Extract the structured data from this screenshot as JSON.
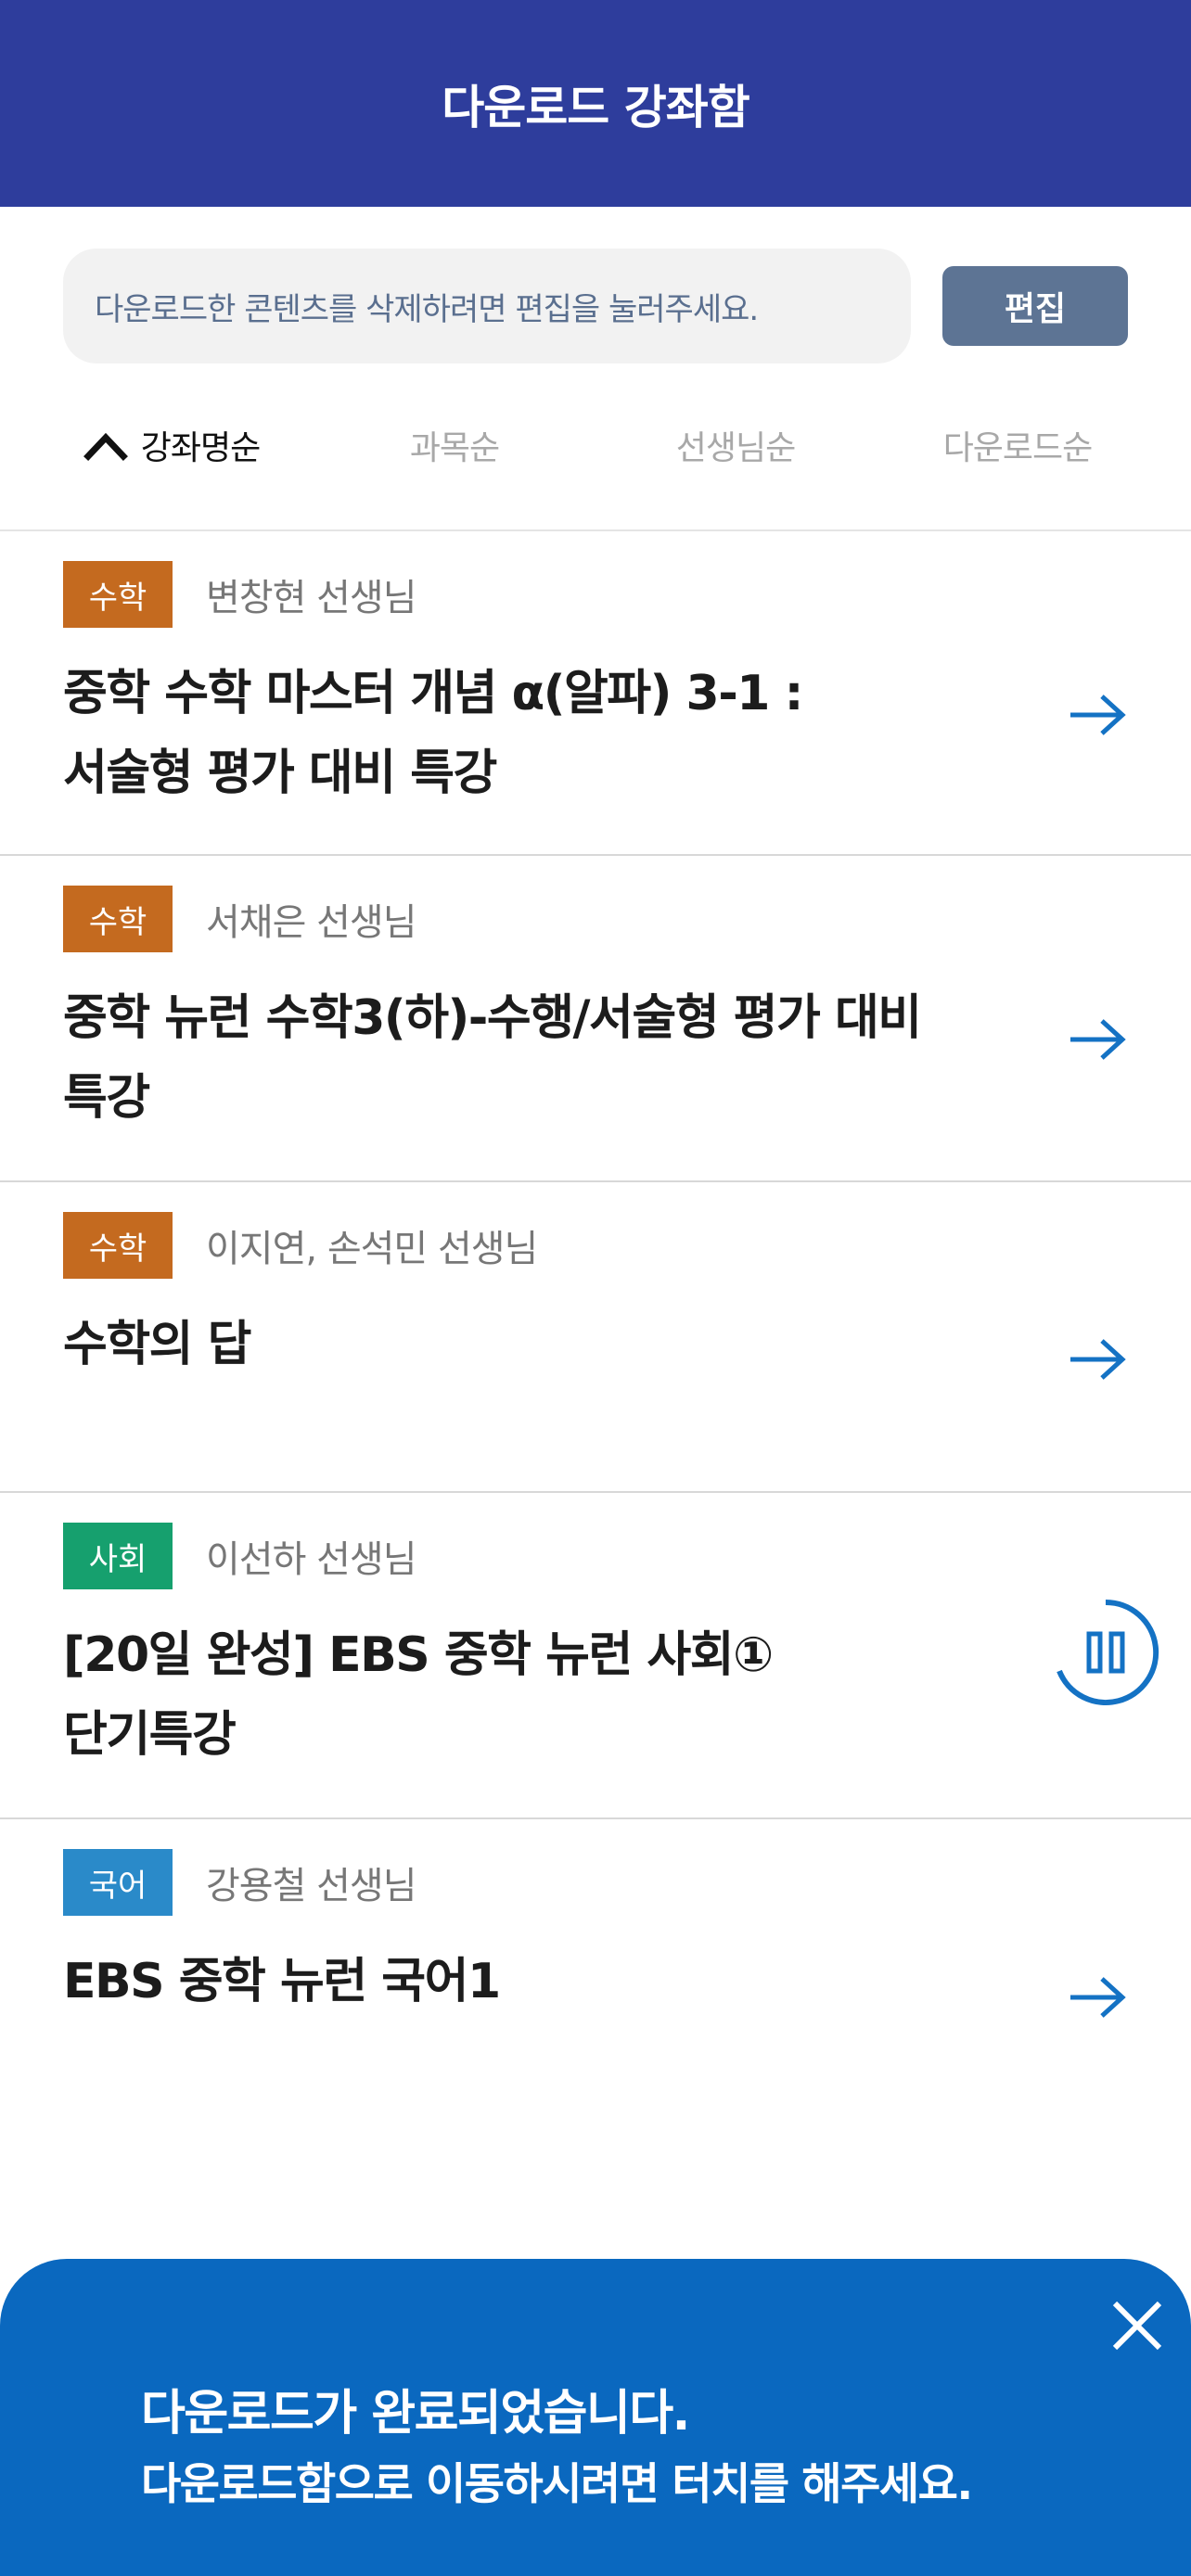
{
  "header": {
    "title": "다운로드 강좌함"
  },
  "info": {
    "message": "다운로드한 콘텐츠를 삭제하려면 편집을 눌러주세요.",
    "edit_label": "편집"
  },
  "sort": {
    "tabs": [
      {
        "label": "강좌명순",
        "active": true,
        "icon": "chevron-up-icon"
      },
      {
        "label": "과목순",
        "active": false
      },
      {
        "label": "선생님순",
        "active": false
      },
      {
        "label": "다운로드순",
        "active": false
      }
    ]
  },
  "courses": [
    {
      "subject": "수학",
      "subject_color": "#c46a1f",
      "teacher": "변창현 선생님",
      "title_line1": "중학 수학 마스터 개념 α(알파) 3-1 :",
      "title_line2": "서술형 평가 대비 특강",
      "status": "arrow-right-icon"
    },
    {
      "subject": "수학",
      "subject_color": "#c46a1f",
      "teacher": "서채은 선생님",
      "title_line1": "중학 뉴런 수학3(하)-수행/서술형 평가 대비",
      "title_line2": "특강",
      "status": "arrow-right-icon"
    },
    {
      "subject": "수학",
      "subject_color": "#c46a1f",
      "teacher": "이지연, 손석민 선생님",
      "title_line1": "수학의 답",
      "title_line2": "",
      "status": "arrow-right-icon"
    },
    {
      "subject": "사회",
      "subject_color": "#16a06e",
      "teacher": "이선하 선생님",
      "title_line1": "[20일 완성] EBS 중학 뉴런 사회①",
      "title_line2": "단기특강",
      "status": "download-pause-icon"
    },
    {
      "subject": "국어",
      "subject_color": "#2a8ac9",
      "teacher": "강용철 선생님",
      "title_line1": "EBS 중학 뉴런 국어1",
      "title_line2": "",
      "status": "arrow-right-icon"
    }
  ],
  "toast": {
    "line1": "다운로드가 완료되었습니다.",
    "line2": "다운로드함으로 이동하시려면 터치를 해주세요.",
    "close_icon": "close-icon"
  },
  "colors": {
    "header": "#2e3d9c",
    "accent": "#0a68bf",
    "edit_button": "#5d7494"
  }
}
